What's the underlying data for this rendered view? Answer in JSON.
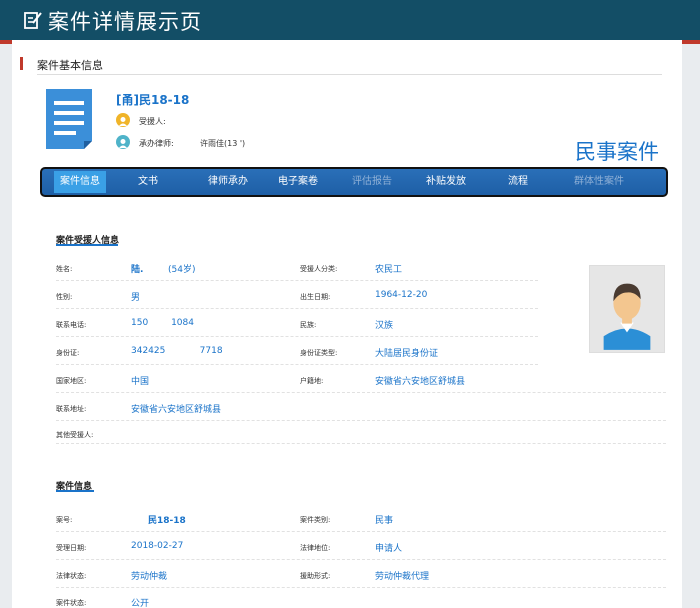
{
  "page": {
    "title": "案件详情展示页"
  },
  "basic_section": {
    "title": "案件基本信息"
  },
  "case_header": {
    "case_no": "[甬]民18-18",
    "aided_person_label": "受援人:",
    "lawyer_label": "承办律师:",
    "lawyer_value": "许雨佳(13                    ')",
    "case_type": "民事案件"
  },
  "tabs": [
    {
      "label": "案件信息",
      "state": "active"
    },
    {
      "label": "文书",
      "state": "normal"
    },
    {
      "label": "律师承办",
      "state": "normal"
    },
    {
      "label": "电子案卷",
      "state": "normal"
    },
    {
      "label": "评估报告",
      "state": "disabled"
    },
    {
      "label": "补贴发放",
      "state": "normal"
    },
    {
      "label": "流程",
      "state": "normal"
    },
    {
      "label": "群体性案件",
      "state": "disabled"
    }
  ],
  "aided_info": {
    "title": "案件受援人信息",
    "fields": {
      "name": {
        "label": "姓名:",
        "value": "陆.",
        "age": "(54岁)"
      },
      "category": {
        "label": "受援人分类:",
        "value": "农民工"
      },
      "gender": {
        "label": "性别:",
        "value": "男"
      },
      "birth": {
        "label": "出生日期:",
        "value": "1964-12-20"
      },
      "phone": {
        "label": "联系电话:",
        "value": "150        1084"
      },
      "ethnicity": {
        "label": "民族:",
        "value": "汉族"
      },
      "id_no": {
        "label": "身份证:",
        "value": "342425            7718"
      },
      "id_type": {
        "label": "身份证类型:",
        "value": "大陆居民身份证"
      },
      "country": {
        "label": "国家地区:",
        "value": "中国"
      },
      "household": {
        "label": "户籍地:",
        "value": "安徽省六安地区舒城县"
      },
      "address": {
        "label": "联系地址:",
        "value": "安徽省六安地区舒城县"
      },
      "other": {
        "label": "其他受援人:",
        "value": ""
      }
    }
  },
  "case_info": {
    "title": "案件信息",
    "fields": {
      "case_no": {
        "label": "案号:",
        "value": "民18-18"
      },
      "case_category": {
        "label": "案件类别:",
        "value": "民事"
      },
      "accept_date": {
        "label": "受理日期:",
        "value": "2018-02-27"
      },
      "legal_position": {
        "label": "法律地位:",
        "value": "申请人"
      },
      "legal_status": {
        "label": "法律状态:",
        "value": "劳动仲裁"
      },
      "aid_form": {
        "label": "援助形式:",
        "value": "劳动仲裁代理"
      },
      "case_status": {
        "label": "案件状态:",
        "value": "公开"
      }
    }
  },
  "colors": {
    "header": "#134e66",
    "accent": "#1a73c9",
    "marker": "#c0392b"
  },
  "icons": {
    "title": "edit-document-icon",
    "doc": "document-icon",
    "avatar": "person-avatar-icon"
  }
}
